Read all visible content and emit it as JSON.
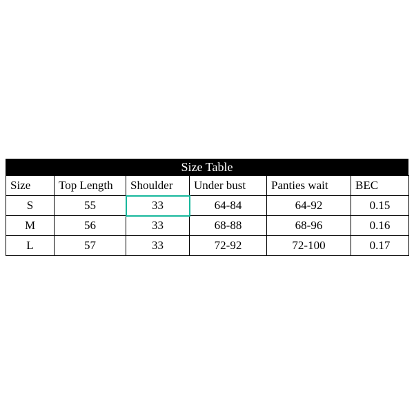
{
  "chart_data": {
    "type": "table",
    "title": "Size Table",
    "columns": [
      "Size",
      "Top Length",
      "Shoulder",
      "Under bust",
      "Panties wait",
      "BEC"
    ],
    "rows": [
      [
        "S",
        "55",
        "33",
        "64-84",
        "64-92",
        "0.15"
      ],
      [
        "M",
        "56",
        "33",
        "68-88",
        "68-96",
        "0.16"
      ],
      [
        "L",
        "57",
        "33",
        "72-92",
        "72-100",
        "0.17"
      ]
    ],
    "highlighted_cell": {
      "row": 0,
      "col": 2
    }
  }
}
